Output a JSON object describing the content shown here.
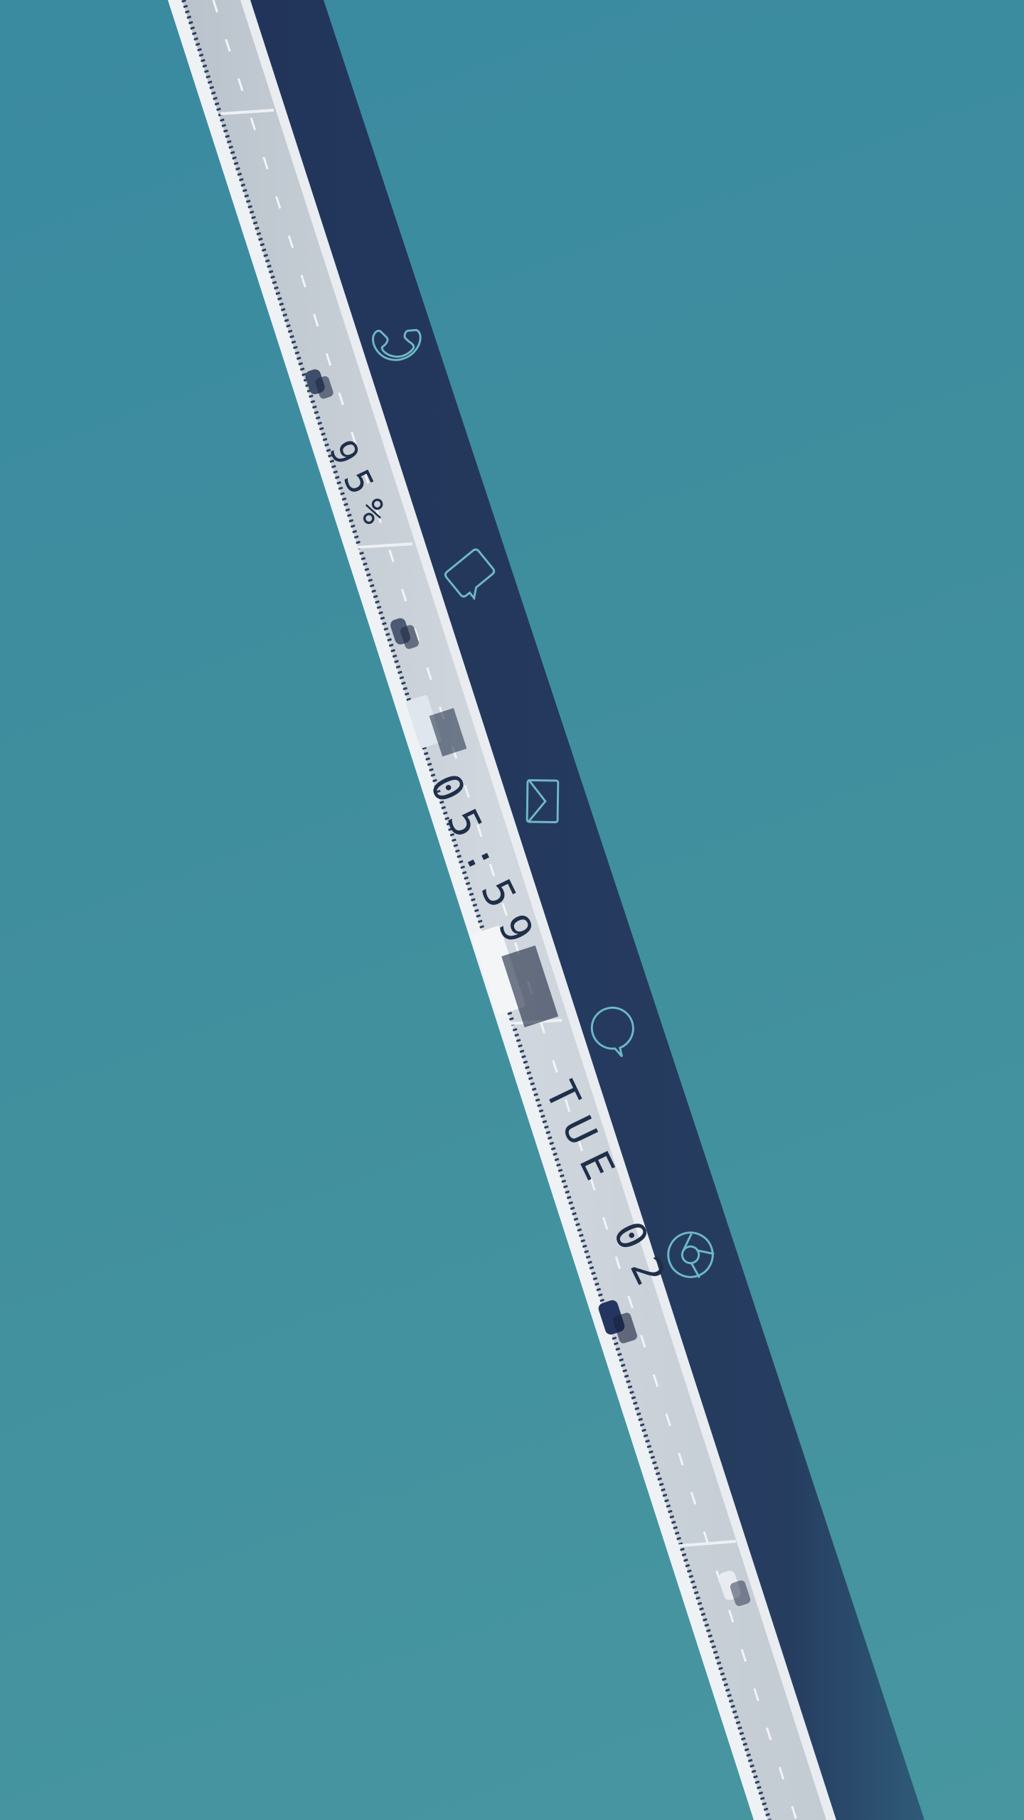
{
  "lockscreen": {
    "battery_text": "95%",
    "time_text": "05:59",
    "date_text": "TUE 02"
  },
  "shortcuts": [
    {
      "icon": "phone-icon"
    },
    {
      "icon": "message-icon"
    },
    {
      "icon": "email-icon"
    },
    {
      "icon": "chat-icon"
    },
    {
      "icon": "browser-icon"
    }
  ],
  "colors": {
    "water": "#3f8e9e",
    "shadow": "#24385a",
    "deck": "#c9cfd6",
    "text": "#1f2f4a",
    "icon_stroke": "#6fb8c6"
  }
}
